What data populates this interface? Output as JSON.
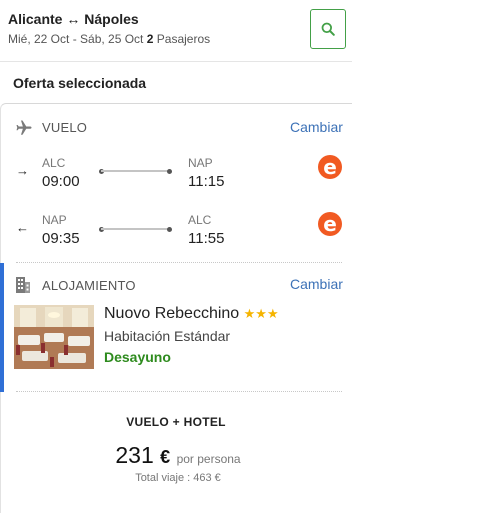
{
  "header": {
    "origin": "Alicante",
    "route_arrow": "↔",
    "destination": "Nápoles",
    "dates": "Mié, 22 Oct - Sáb, 25 Oct",
    "passengers_count": "2",
    "passengers_label": "Pasajeros",
    "search_icon": "search-icon"
  },
  "offer": {
    "title": "Oferta seleccionada"
  },
  "flight": {
    "label": "VUELO",
    "change_label": "Cambiar",
    "icon": "plane-icon",
    "legs": [
      {
        "direction": "→",
        "from_code": "ALC",
        "from_time": "09:00",
        "to_code": "NAP",
        "to_time": "11:15",
        "airline_letter": "e"
      },
      {
        "direction": "←",
        "from_code": "NAP",
        "from_time": "09:35",
        "to_code": "ALC",
        "to_time": "11:55",
        "airline_letter": "e"
      }
    ]
  },
  "lodging": {
    "label": "ALOJAMIENTO",
    "change_label": "Cambiar",
    "icon": "building-icon",
    "hotel_name": "Nuovo Rebecchino",
    "stars": 3,
    "star_glyphs": "★★★",
    "room": "Habitación Estándar",
    "board": "Desayuno"
  },
  "summary": {
    "title": "VUELO + HOTEL",
    "price": "231",
    "currency": "€",
    "per_person": "por persona",
    "total": "Total viaje : 463 €"
  },
  "colors": {
    "accent_blue": "#2f6fd6",
    "link_blue": "#3d72b7",
    "green": "#2e8b1e",
    "search_border": "#43a047",
    "airline_orange": "#f15a22",
    "star_gold": "#f5b400"
  }
}
